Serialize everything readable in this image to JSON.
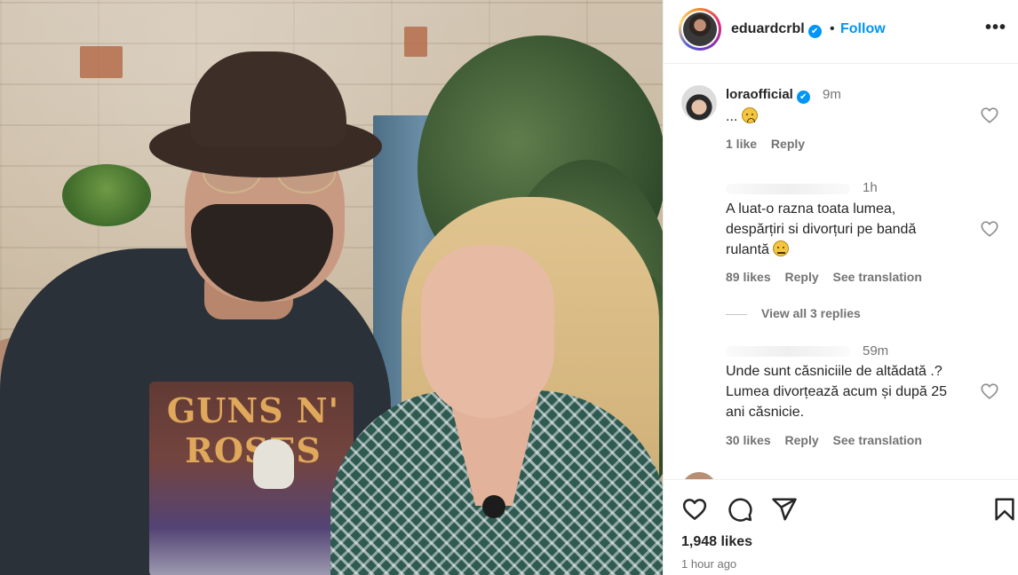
{
  "post": {
    "author": "eduardcrbl",
    "follow_label": "Follow",
    "separator": "•",
    "more_label": "•••",
    "verified_mark": "✔"
  },
  "photo": {
    "shirt_print": "GUNS N' ROSES"
  },
  "comments": [
    {
      "username": "loraofficial",
      "verified": true,
      "time": "9m",
      "text": "...",
      "emoji": "sad",
      "likes": "1 like",
      "reply_label": "Reply"
    },
    {
      "username": "",
      "time": "1h",
      "text_lines": [
        "A luat-o razna toata lumea,",
        "despărțiri si divorțuri pe bandă",
        "rulantă"
      ],
      "emoji": "neutral",
      "likes": "89 likes",
      "reply_label": "Reply",
      "translate_label": "See translation",
      "view_replies": "View all 3 replies"
    },
    {
      "username": "",
      "time": "59m",
      "text_lines": [
        "Unde sunt căsniciile de altădată .?",
        "Lumea divorțează acum și după 25",
        "ani căsnicie."
      ],
      "likes": "30 likes",
      "reply_label": "Reply",
      "translate_label": "See translation"
    }
  ],
  "icons": {
    "like": "heart-icon",
    "comment": "comment-icon",
    "share": "share-icon",
    "save": "bookmark-icon"
  },
  "stats": {
    "likes": "1,948 likes",
    "posted": "1 hour ago"
  },
  "colors": {
    "accent": "#0095f6",
    "text": "#262626",
    "muted": "#737373"
  }
}
